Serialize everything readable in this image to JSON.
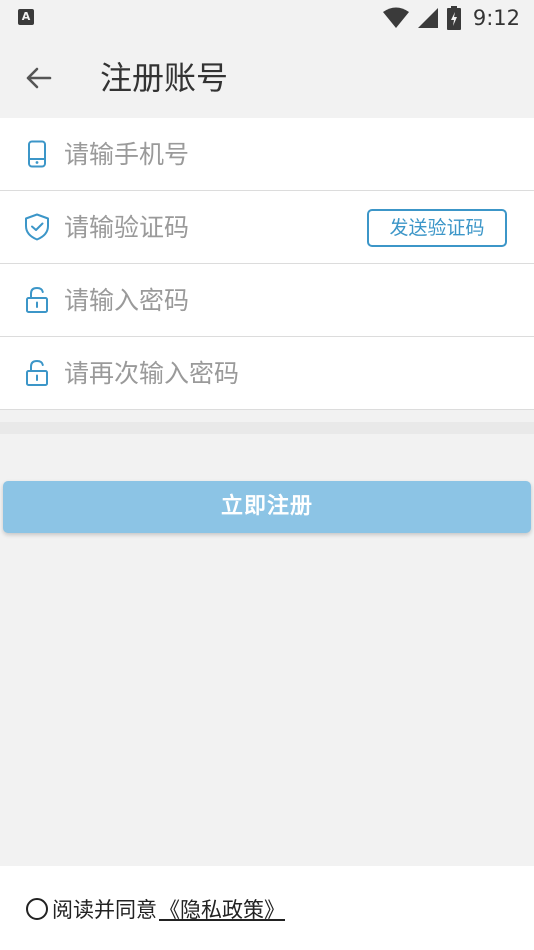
{
  "status_bar": {
    "left_icon": "A",
    "time": "9:12",
    "icons": [
      "wifi-icon",
      "signal-icon",
      "battery-icon"
    ]
  },
  "header": {
    "title": "注册账号",
    "back_icon": "arrow-left-icon"
  },
  "form": {
    "phone": {
      "placeholder": "请输手机号",
      "value": "",
      "icon": "phone-icon"
    },
    "code": {
      "placeholder": "请输验证码",
      "value": "",
      "icon": "shield-check-icon",
      "send_label": "发送验证码"
    },
    "password": {
      "placeholder": "请输入密码",
      "value": "",
      "icon": "lock-icon"
    },
    "password_confirm": {
      "placeholder": "请再次输入密码",
      "value": "",
      "icon": "lock-icon"
    }
  },
  "register": {
    "label": "立即注册"
  },
  "agreement": {
    "text": "阅读并同意",
    "link": "《隐私政策》"
  },
  "colors": {
    "accent": "#3c96c8",
    "button": "#8cc4e5",
    "background": "#f2f2f2"
  }
}
